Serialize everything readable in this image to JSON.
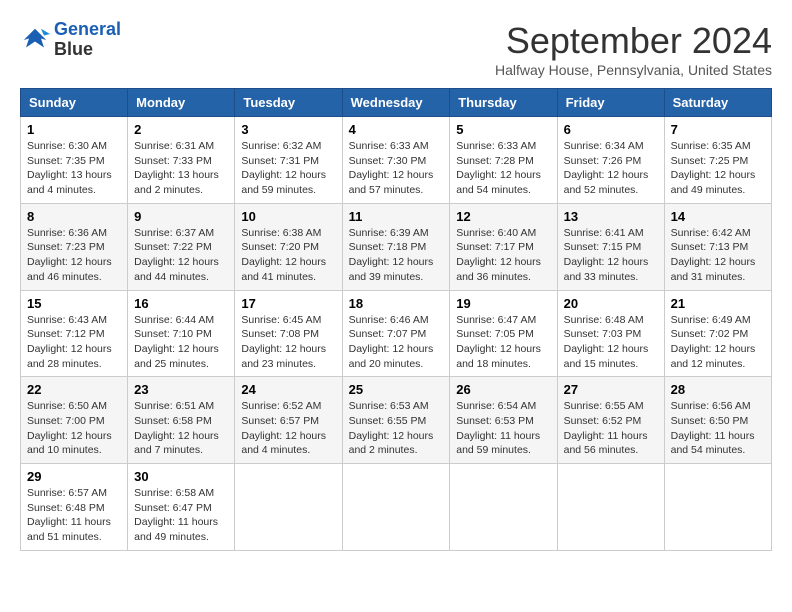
{
  "logo": {
    "line1": "General",
    "line2": "Blue"
  },
  "title": "September 2024",
  "subtitle": "Halfway House, Pennsylvania, United States",
  "days_of_week": [
    "Sunday",
    "Monday",
    "Tuesday",
    "Wednesday",
    "Thursday",
    "Friday",
    "Saturday"
  ],
  "weeks": [
    [
      {
        "day": "1",
        "info": "Sunrise: 6:30 AM\nSunset: 7:35 PM\nDaylight: 13 hours\nand 4 minutes."
      },
      {
        "day": "2",
        "info": "Sunrise: 6:31 AM\nSunset: 7:33 PM\nDaylight: 13 hours\nand 2 minutes."
      },
      {
        "day": "3",
        "info": "Sunrise: 6:32 AM\nSunset: 7:31 PM\nDaylight: 12 hours\nand 59 minutes."
      },
      {
        "day": "4",
        "info": "Sunrise: 6:33 AM\nSunset: 7:30 PM\nDaylight: 12 hours\nand 57 minutes."
      },
      {
        "day": "5",
        "info": "Sunrise: 6:33 AM\nSunset: 7:28 PM\nDaylight: 12 hours\nand 54 minutes."
      },
      {
        "day": "6",
        "info": "Sunrise: 6:34 AM\nSunset: 7:26 PM\nDaylight: 12 hours\nand 52 minutes."
      },
      {
        "day": "7",
        "info": "Sunrise: 6:35 AM\nSunset: 7:25 PM\nDaylight: 12 hours\nand 49 minutes."
      }
    ],
    [
      {
        "day": "8",
        "info": "Sunrise: 6:36 AM\nSunset: 7:23 PM\nDaylight: 12 hours\nand 46 minutes."
      },
      {
        "day": "9",
        "info": "Sunrise: 6:37 AM\nSunset: 7:22 PM\nDaylight: 12 hours\nand 44 minutes."
      },
      {
        "day": "10",
        "info": "Sunrise: 6:38 AM\nSunset: 7:20 PM\nDaylight: 12 hours\nand 41 minutes."
      },
      {
        "day": "11",
        "info": "Sunrise: 6:39 AM\nSunset: 7:18 PM\nDaylight: 12 hours\nand 39 minutes."
      },
      {
        "day": "12",
        "info": "Sunrise: 6:40 AM\nSunset: 7:17 PM\nDaylight: 12 hours\nand 36 minutes."
      },
      {
        "day": "13",
        "info": "Sunrise: 6:41 AM\nSunset: 7:15 PM\nDaylight: 12 hours\nand 33 minutes."
      },
      {
        "day": "14",
        "info": "Sunrise: 6:42 AM\nSunset: 7:13 PM\nDaylight: 12 hours\nand 31 minutes."
      }
    ],
    [
      {
        "day": "15",
        "info": "Sunrise: 6:43 AM\nSunset: 7:12 PM\nDaylight: 12 hours\nand 28 minutes."
      },
      {
        "day": "16",
        "info": "Sunrise: 6:44 AM\nSunset: 7:10 PM\nDaylight: 12 hours\nand 25 minutes."
      },
      {
        "day": "17",
        "info": "Sunrise: 6:45 AM\nSunset: 7:08 PM\nDaylight: 12 hours\nand 23 minutes."
      },
      {
        "day": "18",
        "info": "Sunrise: 6:46 AM\nSunset: 7:07 PM\nDaylight: 12 hours\nand 20 minutes."
      },
      {
        "day": "19",
        "info": "Sunrise: 6:47 AM\nSunset: 7:05 PM\nDaylight: 12 hours\nand 18 minutes."
      },
      {
        "day": "20",
        "info": "Sunrise: 6:48 AM\nSunset: 7:03 PM\nDaylight: 12 hours\nand 15 minutes."
      },
      {
        "day": "21",
        "info": "Sunrise: 6:49 AM\nSunset: 7:02 PM\nDaylight: 12 hours\nand 12 minutes."
      }
    ],
    [
      {
        "day": "22",
        "info": "Sunrise: 6:50 AM\nSunset: 7:00 PM\nDaylight: 12 hours\nand 10 minutes."
      },
      {
        "day": "23",
        "info": "Sunrise: 6:51 AM\nSunset: 6:58 PM\nDaylight: 12 hours\nand 7 minutes."
      },
      {
        "day": "24",
        "info": "Sunrise: 6:52 AM\nSunset: 6:57 PM\nDaylight: 12 hours\nand 4 minutes."
      },
      {
        "day": "25",
        "info": "Sunrise: 6:53 AM\nSunset: 6:55 PM\nDaylight: 12 hours\nand 2 minutes."
      },
      {
        "day": "26",
        "info": "Sunrise: 6:54 AM\nSunset: 6:53 PM\nDaylight: 11 hours\nand 59 minutes."
      },
      {
        "day": "27",
        "info": "Sunrise: 6:55 AM\nSunset: 6:52 PM\nDaylight: 11 hours\nand 56 minutes."
      },
      {
        "day": "28",
        "info": "Sunrise: 6:56 AM\nSunset: 6:50 PM\nDaylight: 11 hours\nand 54 minutes."
      }
    ],
    [
      {
        "day": "29",
        "info": "Sunrise: 6:57 AM\nSunset: 6:48 PM\nDaylight: 11 hours\nand 51 minutes."
      },
      {
        "day": "30",
        "info": "Sunrise: 6:58 AM\nSunset: 6:47 PM\nDaylight: 11 hours\nand 49 minutes."
      },
      {
        "day": "",
        "info": ""
      },
      {
        "day": "",
        "info": ""
      },
      {
        "day": "",
        "info": ""
      },
      {
        "day": "",
        "info": ""
      },
      {
        "day": "",
        "info": ""
      }
    ]
  ]
}
